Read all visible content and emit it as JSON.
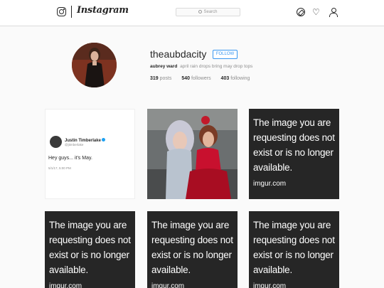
{
  "nav": {
    "brand": "Instagram",
    "search_placeholder": "Search"
  },
  "profile": {
    "username": "theaubdacity",
    "follow_label": "FOLLOW",
    "full_name": "aubrey ward",
    "bio": "april rain drops bring may drop tops",
    "stats": {
      "posts_count": "319",
      "posts_label": "posts",
      "followers_count": "540",
      "followers_label": "followers",
      "following_count": "403",
      "following_label": "following"
    }
  },
  "posts": {
    "tweet": {
      "name": "Justin Timberlake",
      "handle": "@jtimberlake",
      "text": "Hey guys... it's May.",
      "date": "5/1/17, 5:00 PM"
    },
    "missing_message": "The image you are requesting does not exist or is no longer available.",
    "missing_site": "imgur.com"
  },
  "colors": {
    "accent": "#3897f0",
    "border": "#dbdbdb",
    "background": "#fafafa"
  }
}
